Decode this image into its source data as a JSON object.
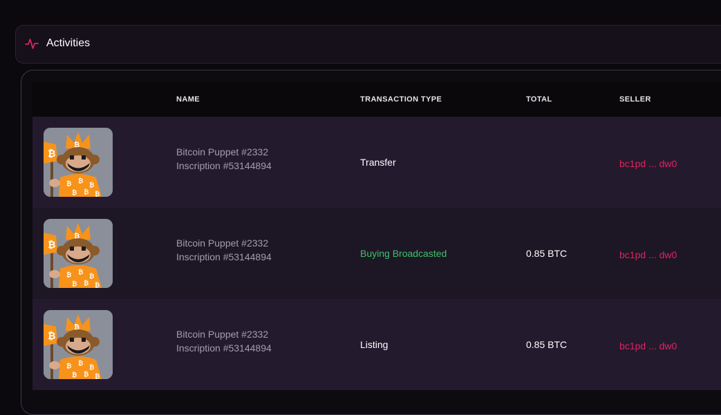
{
  "header": {
    "title": "Activities"
  },
  "table": {
    "columns": [
      "NAME",
      "TRANSACTION TYPE",
      "TOTAL",
      "SELLER"
    ],
    "rows": [
      {
        "name": "Bitcoin Puppet #2332",
        "inscription": "Inscription #53144894",
        "type": "Transfer",
        "type_color": "#ffffff",
        "total": "",
        "seller": "bc1pd ... dw0"
      },
      {
        "name": "Bitcoin Puppet #2332",
        "inscription": "Inscription #53144894",
        "type": "Buying Broadcasted",
        "type_color": "#3cc36a",
        "total": "0.85 BTC",
        "seller": "bc1pd ... dw0"
      },
      {
        "name": "Bitcoin Puppet #2332",
        "inscription": "Inscription #53144894",
        "type": "Listing",
        "type_color": "#ffffff",
        "total": "0.85 BTC",
        "seller": "bc1pd ... dw0"
      }
    ]
  },
  "colors": {
    "accent": "#e0245e",
    "row_a": "#241a2e",
    "row_b": "#1d1625"
  },
  "icons": {
    "header": "activity-pulse-icon"
  }
}
